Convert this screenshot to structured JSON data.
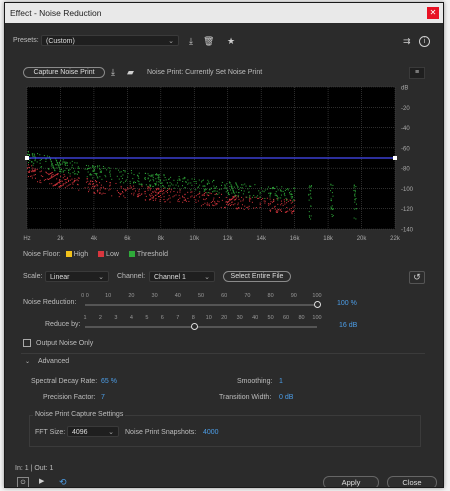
{
  "title": "Effect - Noise Reduction",
  "presets": {
    "label": "Presets:",
    "value": "(Custom)"
  },
  "capture_button": "Capture Noise Print",
  "noise_print_status": "Noise Print: Currently Set Noise Print",
  "graph": {
    "y_labels": [
      "dB",
      "-20",
      "-40",
      "-60",
      "-80",
      "-100",
      "-120",
      "-140"
    ],
    "x_labels": [
      "Hz",
      "2k",
      "4k",
      "6k",
      "8k",
      "10k",
      "12k",
      "14k",
      "16k",
      "18k",
      "20k",
      "22k"
    ],
    "threshold_line_db": -70,
    "colors": {
      "high": "#f2c21b",
      "low": "#d9363e",
      "threshold": "#2faa3a",
      "line": "#3a3fd0"
    }
  },
  "legend": {
    "label": "Noise Floor:",
    "high": "High",
    "low": "Low",
    "threshold": "Threshold"
  },
  "scale": {
    "label": "Scale:",
    "value": "Linear"
  },
  "channel": {
    "label": "Channel:",
    "value": "Channel 1"
  },
  "select_entire_file": "Select Entire File",
  "noise_reduction": {
    "label": "Noise Reduction:",
    "ticks": [
      "0 0",
      "10",
      "20",
      "30",
      "40",
      "50",
      "60",
      "70",
      "80",
      "90",
      "100"
    ],
    "value": "100 %",
    "level": 1.0
  },
  "reduce_by": {
    "label": "Reduce by:",
    "ticks": [
      "1",
      "2",
      "3",
      "4",
      "5",
      "6",
      "7",
      "8",
      "10",
      "20",
      "30",
      "40",
      "50",
      "60",
      "80",
      "100"
    ],
    "value": "16 dB",
    "level": 0.47
  },
  "output_noise_only": "Output Noise Only",
  "advanced": {
    "label": "Advanced",
    "spectral_decay_label": "Spectral Decay Rate:",
    "spectral_decay_value": "65 %",
    "smoothing_label": "Smoothing:",
    "smoothing_value": "1",
    "precision_label": "Precision Factor:",
    "precision_value": "7",
    "transition_label": "Transition Width:",
    "transition_value": "0 dB",
    "capture_settings_label": "Noise Print Capture Settings",
    "fft_label": "FFT Size:",
    "fft_value": "4096",
    "snapshots_label": "Noise Print Snapshots:",
    "snapshots_value": "4000"
  },
  "io_label": "In: 1 | Out: 1",
  "apply": "Apply",
  "close": "Close"
}
